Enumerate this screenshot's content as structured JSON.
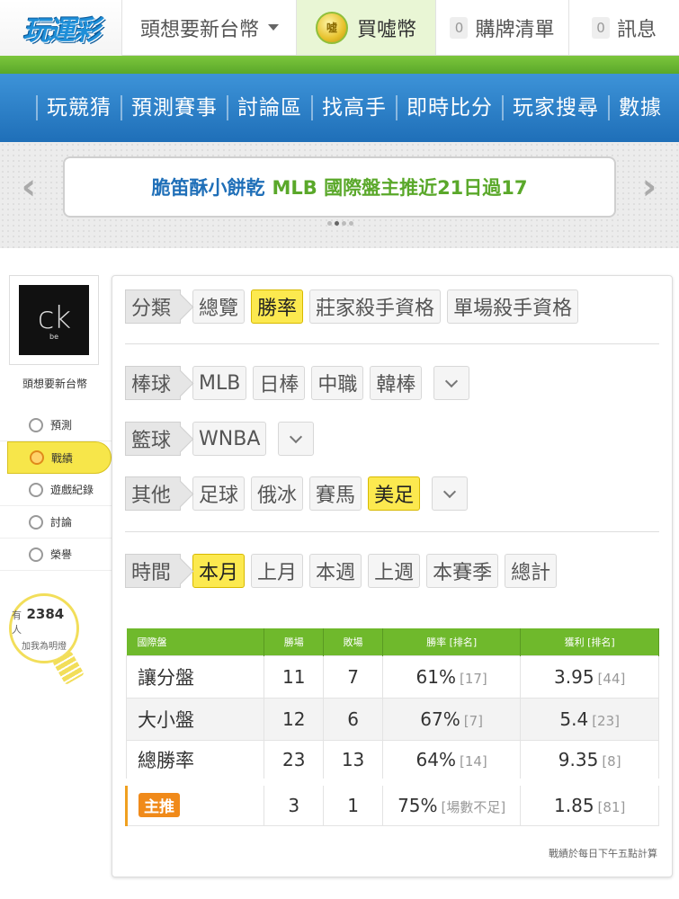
{
  "topbar": {
    "logo_text": "玩運彩",
    "user_name": "頭想要新台幣",
    "buy_coin_label": "買噓幣",
    "coin_icon_text": "噓",
    "cart_count": "0",
    "cart_label": "購牌清單",
    "msg_count": "0",
    "msg_label": "訊息"
  },
  "nav": [
    "玩競猜",
    "預測賽事",
    "討論區",
    "找高手",
    "即時比分",
    "玩家搜尋",
    "數據"
  ],
  "banner": {
    "nickname": "脆笛酥小餅乾",
    "message": "MLB 國際盤主推近21日過17"
  },
  "sidebar": {
    "avatar_text": "ck",
    "avatar_sub": "be",
    "user_name": "頭想要新台幣",
    "menu": [
      "預測",
      "戰績",
      "遊戲紀錄",
      "討論",
      "榮譽"
    ],
    "fans_prefix": "有",
    "fans_count": "2384",
    "fans_suffix": "人",
    "fans_cta": "加我為明燈"
  },
  "filters": {
    "category_label": "分類",
    "category_items": [
      "總覽",
      "勝率",
      "莊家殺手資格",
      "單場殺手資格"
    ],
    "baseball_label": "棒球",
    "baseball_items": [
      "MLB",
      "日棒",
      "中職",
      "韓棒"
    ],
    "basketball_label": "籃球",
    "basketball_items": [
      "WNBA"
    ],
    "other_label": "其他",
    "other_items": [
      "足球",
      "俄冰",
      "賽馬",
      "美足"
    ],
    "time_label": "時間",
    "time_items": [
      "本月",
      "上月",
      "本週",
      "上週",
      "本賽季",
      "總計"
    ]
  },
  "table": {
    "headers": [
      "國際盤",
      "勝場",
      "敗場",
      "勝率 [排名]",
      "獲利 [排名]"
    ],
    "rows": [
      {
        "name": "讓分盤",
        "win": "11",
        "lose": "7",
        "rate": "61%",
        "rate_rank": "[17]",
        "profit": "3.95",
        "profit_rank": "[44]"
      },
      {
        "name": "大小盤",
        "win": "12",
        "lose": "6",
        "rate": "67%",
        "rate_rank": "[7]",
        "profit": "5.4",
        "profit_rank": "[23]"
      },
      {
        "name": "總勝率",
        "win": "23",
        "lose": "13",
        "rate": "64%",
        "rate_rank": "[14]",
        "profit": "9.35",
        "profit_rank": "[8]"
      }
    ],
    "main_pick": {
      "name": "主推",
      "win": "3",
      "lose": "1",
      "rate": "75%",
      "rate_rank": "[場數不足]",
      "profit": "1.85",
      "profit_rank": "[81]"
    },
    "note": "戰績於每日下午五點計算"
  }
}
